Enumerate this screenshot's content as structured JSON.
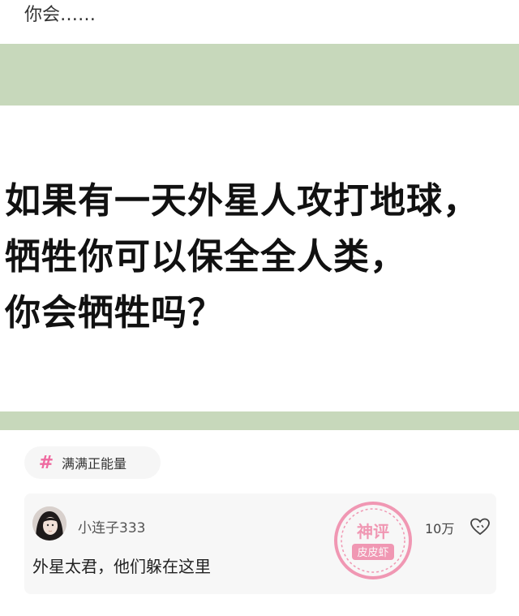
{
  "post": {
    "text": "你会……"
  },
  "image": {
    "lines": [
      "如果有一天外星人攻打地球，",
      "牺牲你可以保全全人类，",
      "你会牺牲吗？"
    ]
  },
  "tag": {
    "symbol": "#",
    "label": "满满正能量"
  },
  "comment": {
    "username": "小连子333",
    "text": "外星太君，他们躲在这里",
    "like_count": "10万",
    "stamp_top": "神评",
    "stamp_bottom": "皮皮虾"
  },
  "colors": {
    "image_band": "#c7d8bb",
    "tag_accent": "#ef6aa0",
    "stamp": "#ec4a7c"
  }
}
